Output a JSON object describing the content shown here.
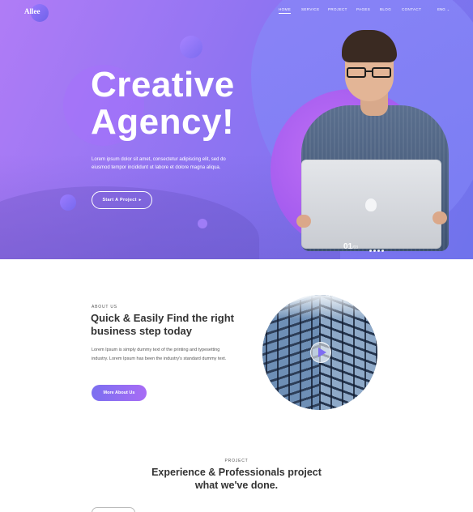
{
  "brand": {
    "logo": "Allee"
  },
  "nav": {
    "items": [
      {
        "label": "HOME",
        "active": true
      },
      {
        "label": "SERVICE",
        "active": false
      },
      {
        "label": "PROJECT",
        "active": false
      },
      {
        "label": "PAGES",
        "active": false
      },
      {
        "label": "BLOG",
        "active": false
      },
      {
        "label": "CONTACT",
        "active": false
      }
    ],
    "language": "ENG"
  },
  "hero": {
    "title_line1": "Creative",
    "title_line2": "Agency!",
    "text": "Lorem ipsum dolor sit amet, consectetur adipiscing elit, sed do eiusmod tempor incididunt ut labore et dolore magna aliqua.",
    "button_label": "Start A Project",
    "slide_current": "01",
    "slide_total": "/03",
    "slide_dots": 4
  },
  "about": {
    "label": "ABOUT US",
    "title_line1": "Quick & Easily Find the right",
    "title_line2": "business step today",
    "text": "Lorem Ipsum is simply dummy text of the printing and typesetting industry. Lorem Ipsum has been the industry's standard dummy text.",
    "button_label": "More About Us"
  },
  "project": {
    "label": "PROJECT",
    "title_line1": "Experience & Professionals project",
    "title_line2": "what we've done."
  },
  "colors": {
    "accent_start": "#7b6ff0",
    "accent_end": "#a86cf5",
    "hero_gradient_start": "#b07cf6",
    "hero_gradient_end": "#6f73ec"
  }
}
